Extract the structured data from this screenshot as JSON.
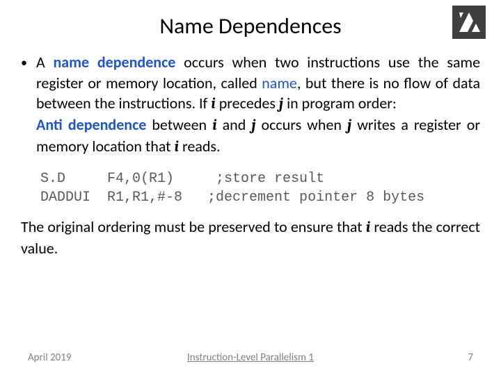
{
  "title": "Name Dependences",
  "para1": {
    "lead": "A ",
    "kw": "name dependence",
    "after_kw": " occurs when two instructions use the same register or memory location, called ",
    "name_word": "name",
    "after_name": ", but there is no flow of data between the instructions. If ",
    "var_i": "i",
    "mid": " precedes ",
    "var_j": "j",
    "tail": " in program order:"
  },
  "para2": {
    "kw": "Anti dependence",
    "after_kw": " between ",
    "var_i1": "i",
    "mid1": " and ",
    "var_j1": "j",
    "mid2": " occurs when ",
    "var_j2": "j",
    "mid3": " writes a register or memory location that ",
    "var_i2": "i",
    "tail": " reads."
  },
  "code": "S.D     F4,0(R1)     ;store result\nDADDUI  R1,R1,#-8   ;decrement pointer 8 bytes",
  "para3": {
    "lead": "The original ordering must be preserved to ensure that ",
    "var_i": "i",
    "tail": " reads the correct value."
  },
  "footer": {
    "left": "April 2019",
    "center": "Instruction-Level Parallelism 1",
    "right": "7"
  }
}
